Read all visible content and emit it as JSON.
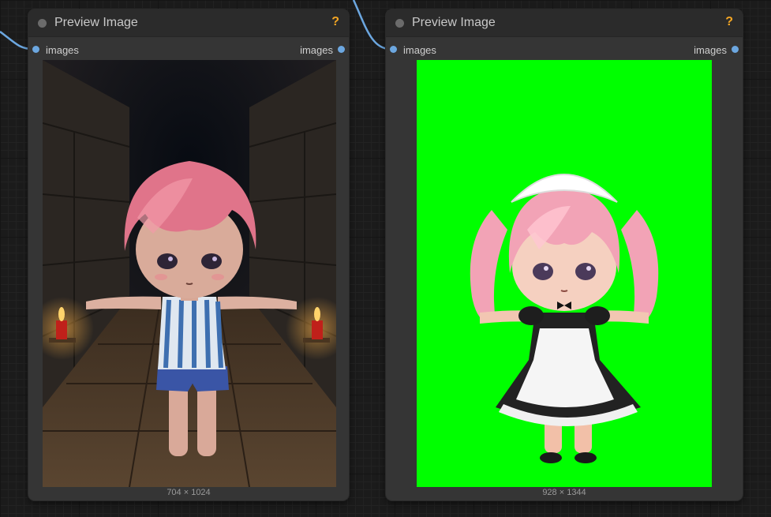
{
  "nodes": [
    {
      "title": "Preview Image",
      "help_icon": "?",
      "input_label": "images",
      "output_label": "images",
      "image_description": "chibi figure with pink short hair in striped tank top standing in stone dungeon corridor with candles",
      "dimensions": "704 × 1024"
    },
    {
      "title": "Preview Image",
      "help_icon": "?",
      "input_label": "images",
      "output_label": "images",
      "image_description": "chibi maid with pink twin-tails on bright green background",
      "dimensions": "928 × 1344"
    }
  ],
  "colors": {
    "canvas_bg": "#1b1b1b",
    "node_bg": "#353535",
    "slot": "#6ca7e0",
    "help": "#f5a623",
    "green_screen": "#00ff00"
  }
}
